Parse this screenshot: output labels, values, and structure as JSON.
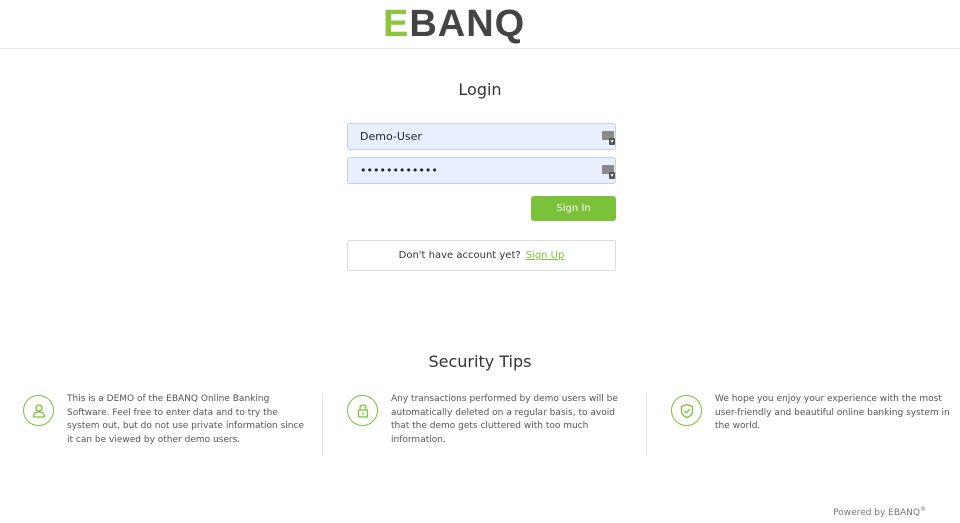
{
  "brand": {
    "logo_first": "E",
    "logo_rest": "BANQ",
    "accent_color": "#8cc63f"
  },
  "login": {
    "title": "Login",
    "username_value": "Demo-User",
    "password_value": "••••••••••••",
    "field_icon": "password-manager-key-icon",
    "signin_label": "Sign In",
    "no_account_text": "Don't have account yet?",
    "signup_label": "Sign Up"
  },
  "security": {
    "title": "Security Tips",
    "tips": [
      {
        "icon": "user-icon",
        "text": "This is a DEMO of the EBANQ Online Banking Software. Feel free to enter data and to try the system out, but do not use private information since it can be viewed by other demo users."
      },
      {
        "icon": "lock-icon",
        "text": "Any transactions performed by demo users will be automatically deleted on a regular basis, to avoid that the demo gets cluttered with too much information."
      },
      {
        "icon": "shield-check-icon",
        "text": "We hope you enjoy your experience with the most user-friendly and beautiful online banking system in the world."
      }
    ]
  },
  "footer": {
    "powered_by": "Powered by EBANQ",
    "registered": "®"
  }
}
